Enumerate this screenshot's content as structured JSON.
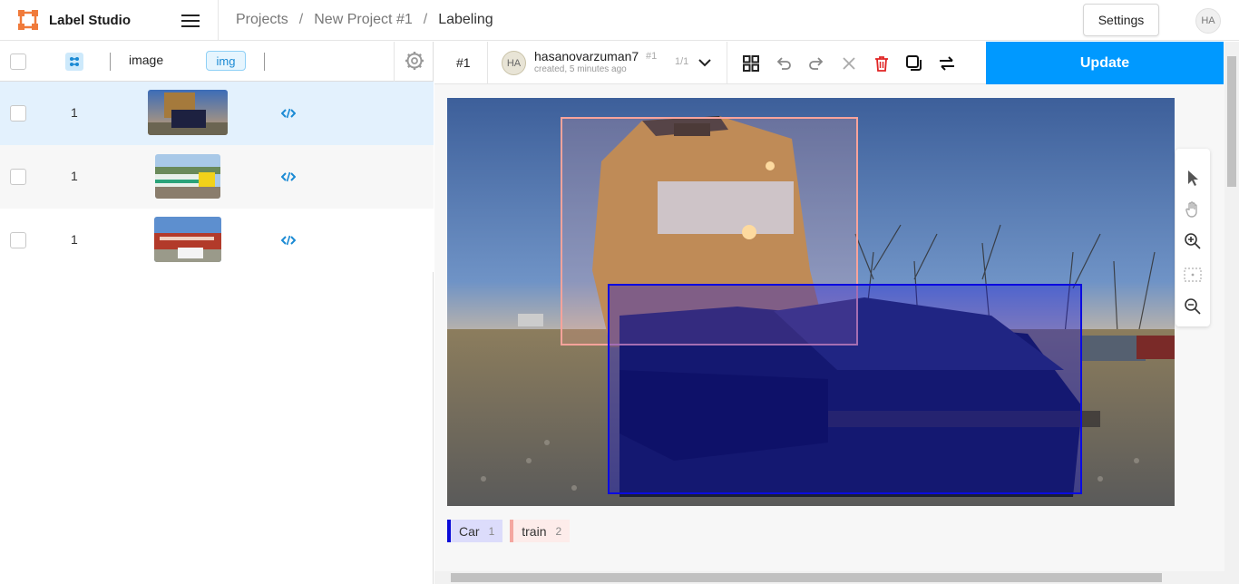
{
  "app": {
    "title": "Label Studio"
  },
  "breadcrumb": {
    "items": [
      "Projects",
      "New Project #1",
      "Labeling"
    ],
    "separator": "/"
  },
  "header": {
    "settings_label": "Settings",
    "user_initials": "HA"
  },
  "table": {
    "columns": {
      "image": "image",
      "img_tag": "img"
    },
    "rows": [
      {
        "count": "1",
        "selected": true
      },
      {
        "count": "1",
        "selected": false
      },
      {
        "count": "1",
        "selected": false
      }
    ]
  },
  "annotation": {
    "id": "#1",
    "user_initials": "HA",
    "username": "hasanovarzuman7",
    "user_id": "#1",
    "created": "created, 5 minutes ago",
    "count": "1/1",
    "update_label": "Update"
  },
  "canvas": {
    "regions": [
      {
        "label": "train",
        "color": "#f8a39b"
      },
      {
        "label": "Car",
        "color": "#0b0be0"
      }
    ]
  },
  "labels": [
    {
      "name": "Car",
      "count": "1",
      "color": "#0b0bd8",
      "bg": "#dcdcfb"
    },
    {
      "name": "train",
      "count": "2",
      "color": "#f4a7a0",
      "bg": "#fdecea"
    }
  ],
  "colors": {
    "accent": "#0099ff",
    "selected_row": "#e3f1fd",
    "alt_row": "#f7f7f7"
  },
  "icons": [
    "menu-icon",
    "grid-icon",
    "gear-icon",
    "code-icon",
    "chevron-down-icon",
    "grid-view-icon",
    "undo-icon",
    "redo-icon",
    "close-icon",
    "trash-icon",
    "duplicate-icon",
    "swap-icon",
    "pointer-icon",
    "hand-icon",
    "zoom-in-icon",
    "fit-icon",
    "zoom-out-icon"
  ]
}
